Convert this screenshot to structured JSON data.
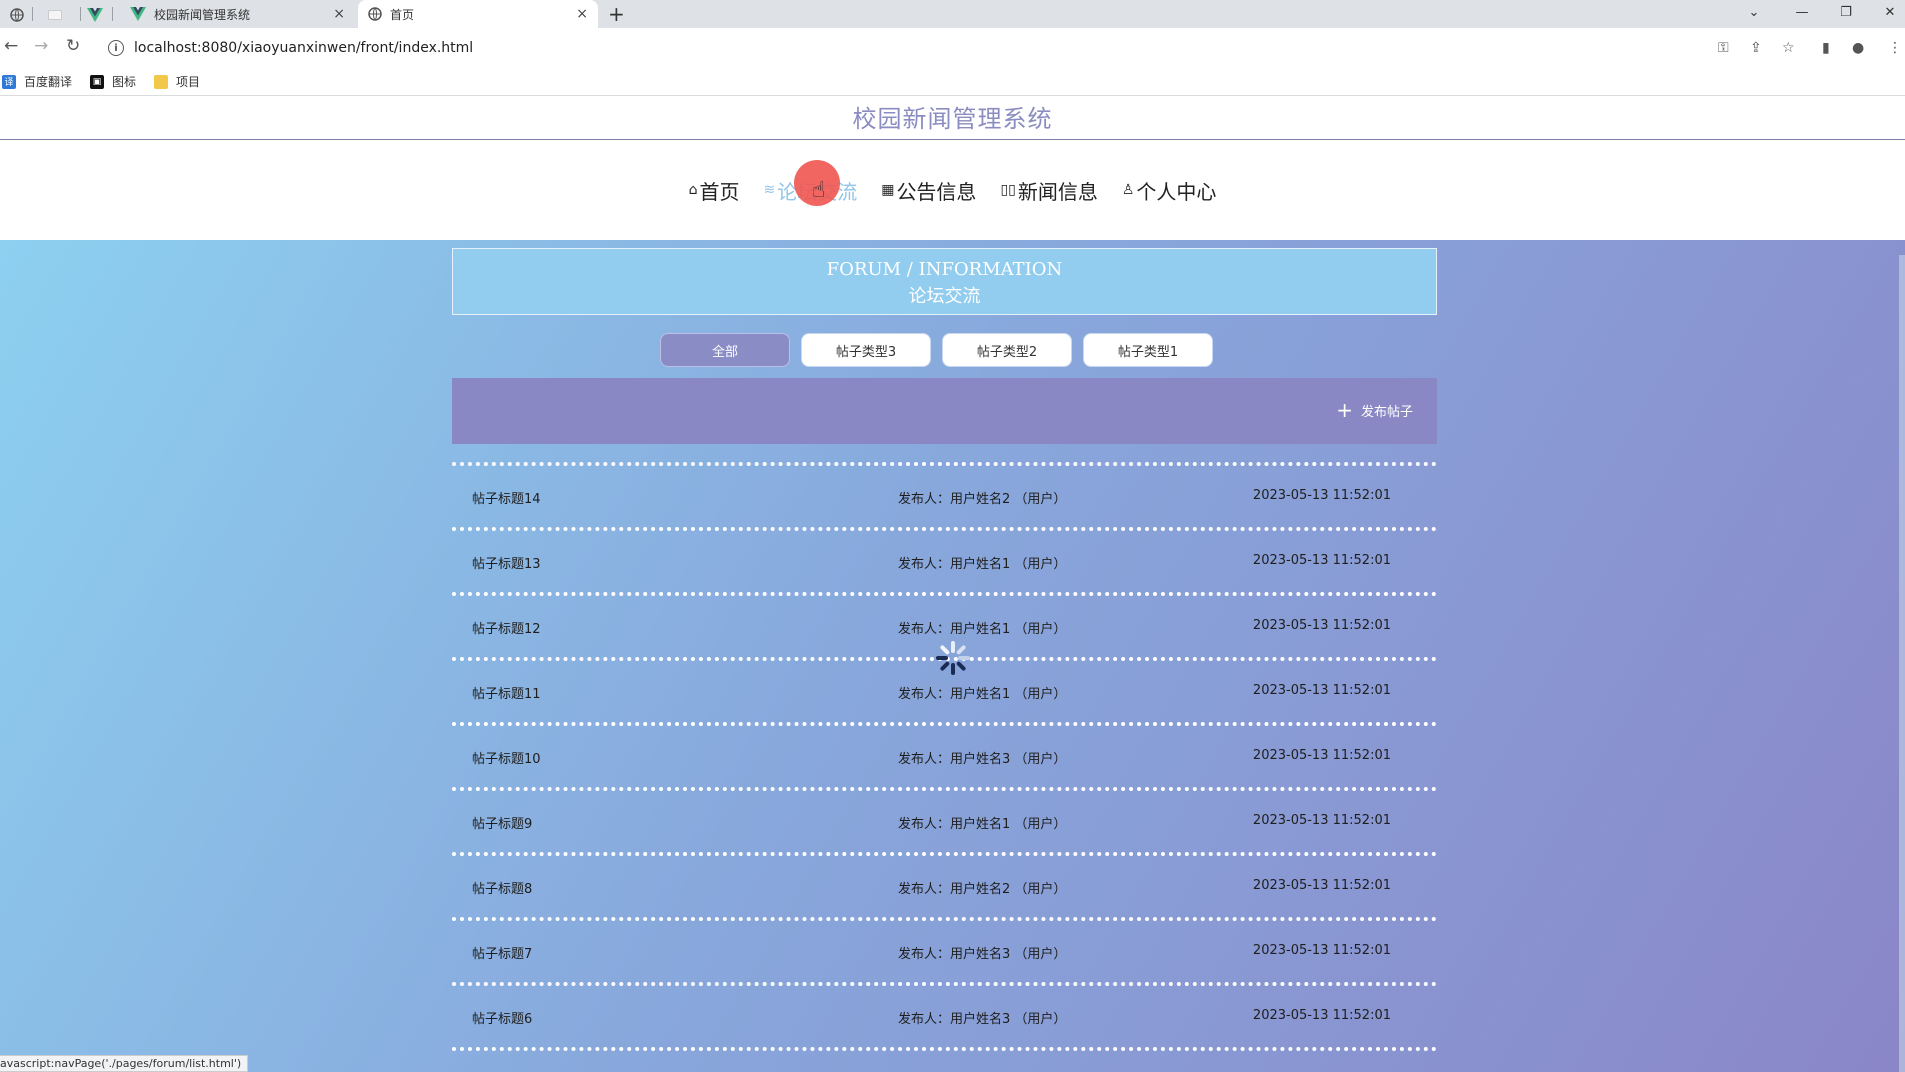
{
  "browser": {
    "tabs": [
      {
        "title": "校园新闻管理系统",
        "close": "×"
      },
      {
        "title": "首页",
        "close": "×"
      }
    ],
    "new_tab": "+",
    "url": "localhost:8080/xiaoyuanxinwen/front/index.html",
    "bookmarks": [
      {
        "label": "百度翻译",
        "color": "#2f7ad6"
      },
      {
        "label": "图标",
        "color": "#111111"
      },
      {
        "label": "项目",
        "color": "#f2c84b"
      }
    ],
    "status_text": "avascript:navPage('./pages/forum/list.html')"
  },
  "site": {
    "title": "校园新闻管理系统"
  },
  "nav": [
    {
      "icon": "⌂",
      "label": "首页"
    },
    {
      "icon": "≋",
      "label": "论坛交流"
    },
    {
      "icon": "▦",
      "label": "公告信息"
    },
    {
      "icon": "▯▯",
      "label": "新闻信息"
    },
    {
      "icon": "♙",
      "label": "个人中心"
    }
  ],
  "banner": {
    "en": "FORUM / INFORMATION",
    "cn": "论坛交流"
  },
  "filters": [
    "全部",
    "帖子类型3",
    "帖子类型2",
    "帖子类型1"
  ],
  "publish_label": "发布帖子",
  "posts": [
    {
      "title": "帖子标题14",
      "author": "发布人：用户姓名2 （用户）",
      "date": "2023-05-13 11:52:01"
    },
    {
      "title": "帖子标题13",
      "author": "发布人：用户姓名1 （用户）",
      "date": "2023-05-13 11:52:01"
    },
    {
      "title": "帖子标题12",
      "author": "发布人：用户姓名1 （用户）",
      "date": "2023-05-13 11:52:01"
    },
    {
      "title": "帖子标题11",
      "author": "发布人：用户姓名1 （用户）",
      "date": "2023-05-13 11:52:01"
    },
    {
      "title": "帖子标题10",
      "author": "发布人：用户姓名3 （用户）",
      "date": "2023-05-13 11:52:01"
    },
    {
      "title": "帖子标题9",
      "author": "发布人：用户姓名1 （用户）",
      "date": "2023-05-13 11:52:01"
    },
    {
      "title": "帖子标题8",
      "author": "发布人：用户姓名2 （用户）",
      "date": "2023-05-13 11:52:01"
    },
    {
      "title": "帖子标题7",
      "author": "发布人：用户姓名3 （用户）",
      "date": "2023-05-13 11:52:01"
    },
    {
      "title": "帖子标题6",
      "author": "发布人：用户姓名3 （用户）",
      "date": "2023-05-13 11:52:01"
    }
  ]
}
